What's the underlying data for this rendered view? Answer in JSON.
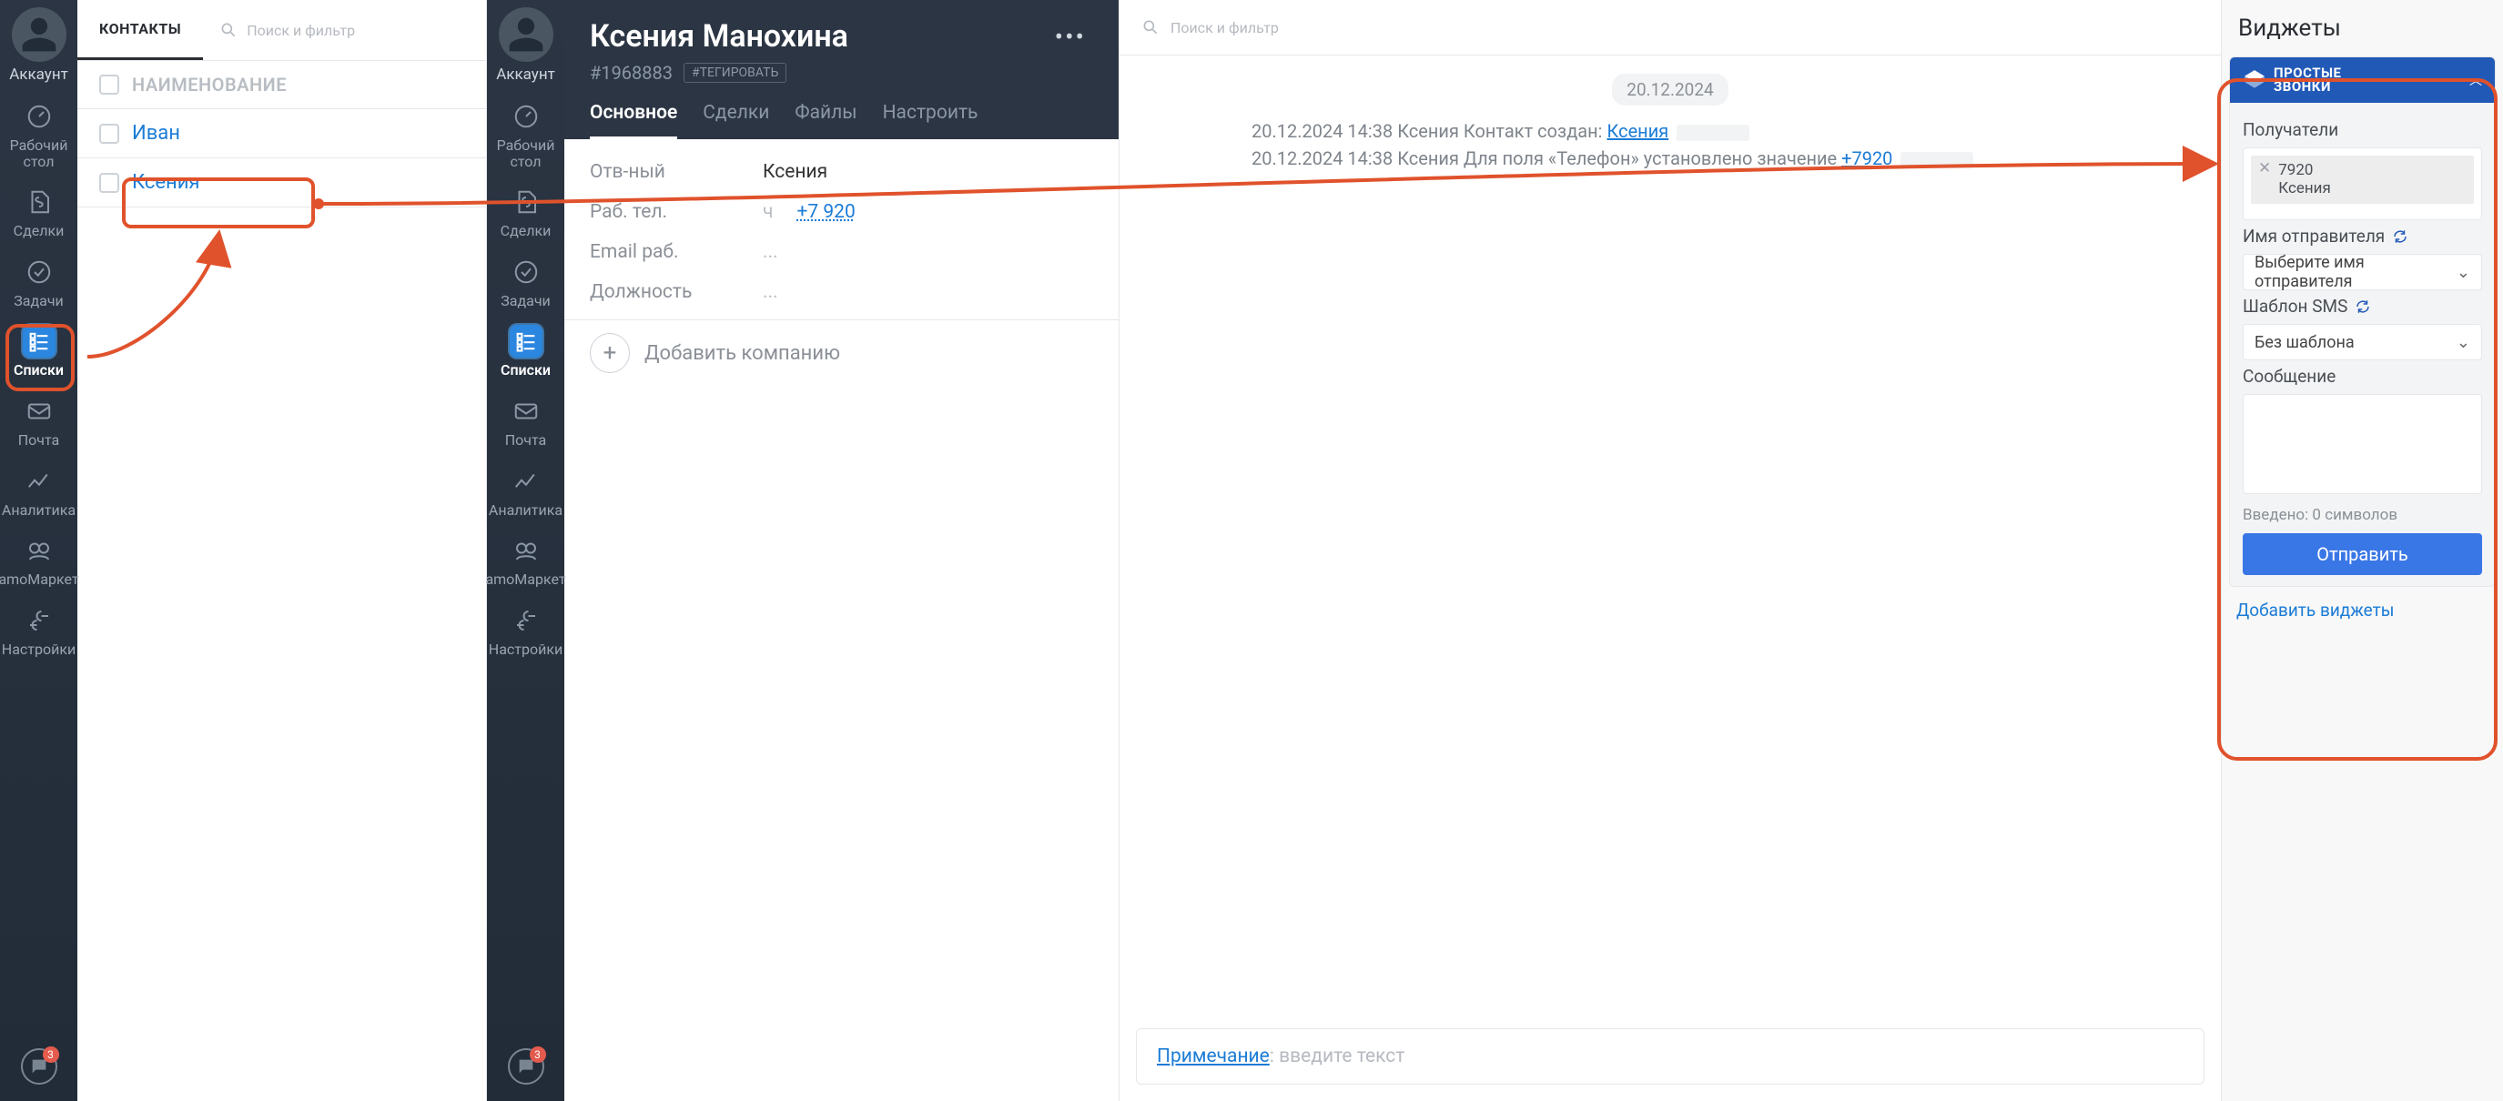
{
  "nav": {
    "account": "Аккаунт",
    "items": [
      {
        "label": "Рабочий\nстол",
        "icon": "dashboard"
      },
      {
        "label": "Сделки",
        "icon": "deals"
      },
      {
        "label": "Задачи",
        "icon": "tasks"
      },
      {
        "label": "Списки",
        "icon": "lists",
        "active": true
      },
      {
        "label": "Почта",
        "icon": "mail"
      },
      {
        "label": "Аналитика",
        "icon": "analytics"
      },
      {
        "label": "amoМаркет",
        "icon": "market"
      },
      {
        "label": "Настройки",
        "icon": "settings"
      }
    ],
    "chat_badge": "3"
  },
  "contacts": {
    "title": "КОНТАКТЫ",
    "search_placeholder": "Поиск и фильтр",
    "col_name": "НАИМЕНОВАНИЕ",
    "rows": [
      {
        "name": "Иван"
      },
      {
        "name": "Ксения"
      }
    ]
  },
  "detail": {
    "name": "Ксения Манохина",
    "id_prefix": "#",
    "id": "1968883",
    "tag_btn": "#ТЕГИРОВАТЬ",
    "tabs": [
      {
        "label": "Основное",
        "active": true
      },
      {
        "label": "Сделки"
      },
      {
        "label": "Файлы"
      },
      {
        "label": "Настроить"
      }
    ],
    "fields": {
      "responsible": {
        "label": "Отв-ный",
        "value": "Ксения"
      },
      "work_phone": {
        "label": "Раб. тел.",
        "value": "+7 920",
        "prefix": "ч"
      },
      "work_email": {
        "label": "Email раб.",
        "value": "..."
      },
      "position": {
        "label": "Должность",
        "value": "..."
      }
    },
    "add_company": "Добавить компанию"
  },
  "timeline": {
    "search_placeholder": "Поиск и фильтр",
    "date_pill": "20.12.2024",
    "logs": [
      {
        "ts": "20.12.2024 14:38",
        "user": "Ксения",
        "text": "Контакт создан:",
        "link": "Ксения"
      },
      {
        "ts": "20.12.2024 14:38",
        "user": "Ксения",
        "text": "Для поля «Телефон» установлено значение",
        "tail": "+7920"
      }
    ],
    "note_label": "Примечание",
    "note_placeholder": ": введите текст"
  },
  "widgets": {
    "title": "Виджеты",
    "brand_line1": "ПРОСТЫЕ",
    "brand_line2": "ЗВОНКИ",
    "recipients_label": "Получатели",
    "recipient": {
      "phone": "7920",
      "name": "Ксения"
    },
    "sender_label": "Имя отправителя",
    "sender_select": "Выберите имя отправителя",
    "template_label": "Шаблон SMS",
    "template_select": "Без шаблона",
    "message_label": "Сообщение",
    "charcount": "Введено: 0 символов",
    "send": "Отправить",
    "add_widgets": "Добавить виджеты"
  }
}
